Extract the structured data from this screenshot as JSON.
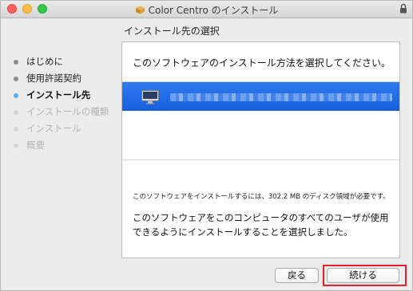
{
  "window": {
    "title": "Color Centro のインストール",
    "icons": {
      "package": "package-icon",
      "lock": "lock-icon"
    }
  },
  "section_title": "インストール先の選択",
  "sidebar": {
    "steps": [
      {
        "label": "はじめに",
        "state": "done"
      },
      {
        "label": "使用許諾契約",
        "state": "done"
      },
      {
        "label": "インストール先",
        "state": "current"
      },
      {
        "label": "インストールの種類",
        "state": "pending"
      },
      {
        "label": "インストール",
        "state": "pending"
      },
      {
        "label": "概要",
        "state": "pending"
      }
    ]
  },
  "main": {
    "prompt": "このソフトウェアのインストール方法を選択してください。",
    "destinations": [
      {
        "icon": "imac-icon",
        "name_obscured": true,
        "selected": true
      }
    ],
    "space_note": "このソフトウェアをインストールするには、302.2 MB のディスク領域が必要です。",
    "selection_note": "このソフトウェアをこのコンピュータのすべてのユーザが使用できるようにインストールすることを選択しました。"
  },
  "buttons": {
    "back": "戻る",
    "continue": "続ける"
  },
  "colors": {
    "selection": "#1a66e0",
    "current_step_dot": "#5aa6f5",
    "highlight_box": "#e8202a"
  }
}
